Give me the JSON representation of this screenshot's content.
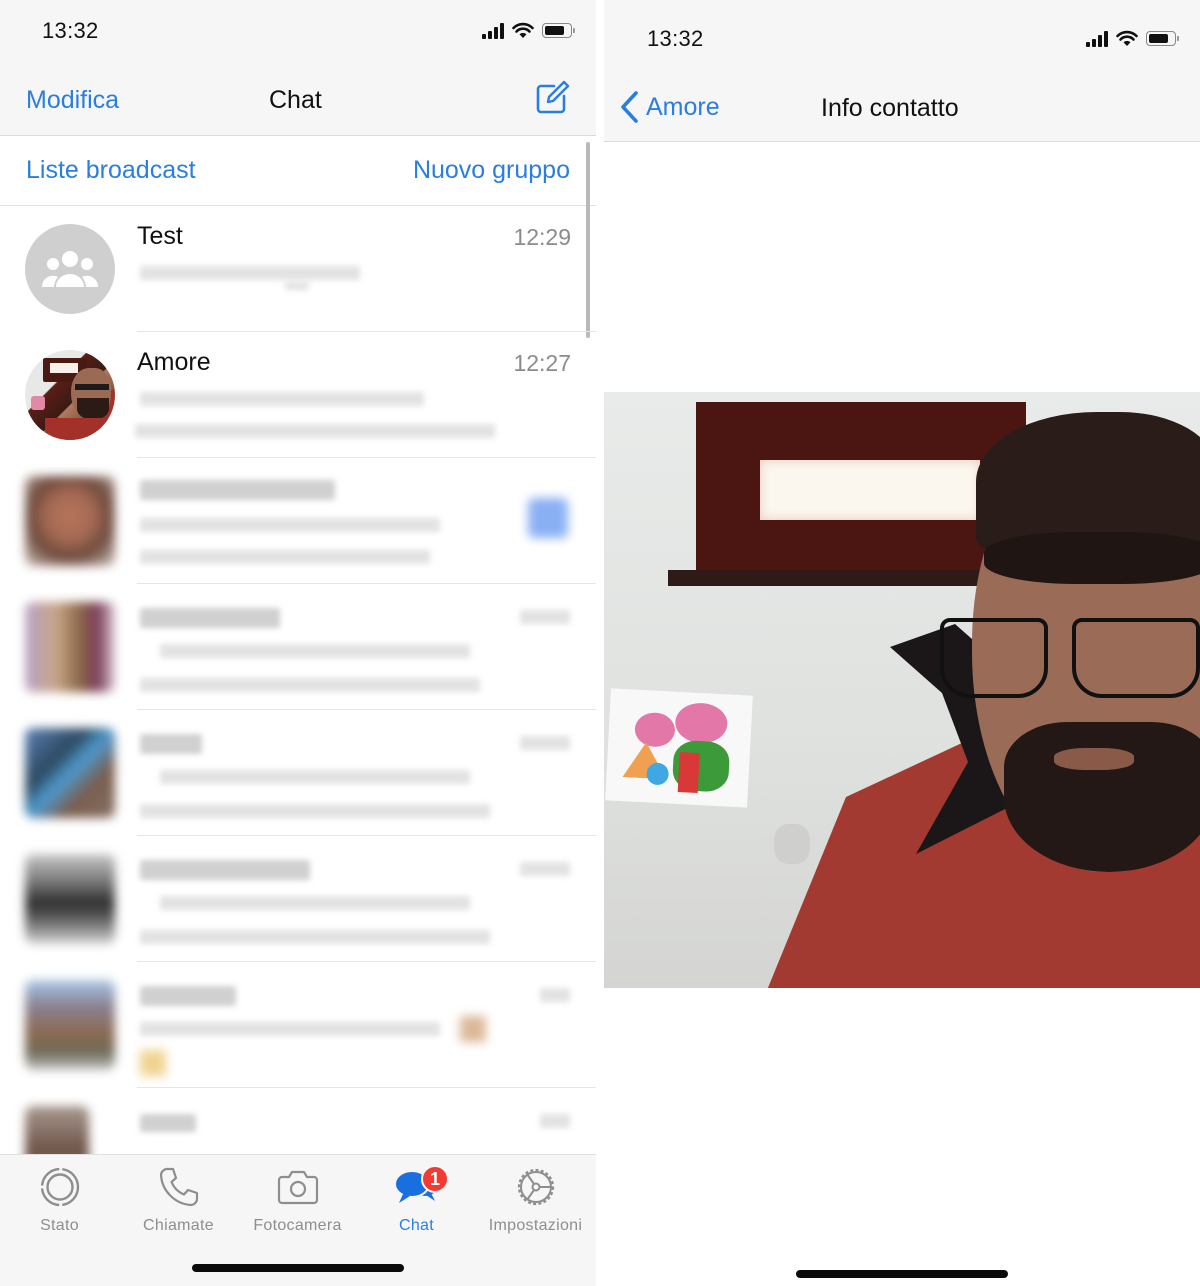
{
  "left_screen": {
    "status_bar": {
      "time": "13:32",
      "icons": [
        "cellular-signal-icon",
        "wifi-icon",
        "battery-icon"
      ]
    },
    "nav": {
      "edit_label": "Modifica",
      "title": "Chat",
      "compose_icon": "compose-icon"
    },
    "sub_actions": {
      "broadcast_label": "Liste broadcast",
      "new_group_label": "Nuovo gruppo"
    },
    "chats": [
      {
        "name": "Test",
        "time": "12:29",
        "avatar": "group-icon",
        "preview": "[blurred]"
      },
      {
        "name": "Amore",
        "time": "12:27",
        "avatar": "contact-photo",
        "preview": "[blurred]"
      },
      {
        "name": "[blurred]",
        "time": "[blurred]",
        "avatar": "blurred-photo",
        "preview": "[blurred]",
        "unread_badge": true
      },
      {
        "name": "[blurred]",
        "time": "[blurred]",
        "avatar": "blurred-photo",
        "preview": "[blurred]"
      },
      {
        "name": "[blurred]",
        "time": "[blurred]",
        "avatar": "blurred-photo",
        "preview": "[blurred]"
      },
      {
        "name": "[blurred]",
        "time": "[blurred]",
        "avatar": "blurred-photo",
        "preview": "[blurred]"
      },
      {
        "name": "[blurred]",
        "time": "[blurred]",
        "avatar": "blurred-photo",
        "preview": "[blurred]"
      },
      {
        "name": "[blurred]",
        "time": "[blurred]",
        "avatar": "blurred-photo",
        "preview": "[blurred]"
      }
    ],
    "tabs": [
      {
        "label": "Stato",
        "icon": "status-ring-icon",
        "active": false
      },
      {
        "label": "Chiamate",
        "icon": "phone-icon",
        "active": false
      },
      {
        "label": "Fotocamera",
        "icon": "camera-icon",
        "active": false
      },
      {
        "label": "Chat",
        "icon": "chat-bubbles-icon",
        "active": true,
        "badge": "1"
      },
      {
        "label": "Impostazioni",
        "icon": "settings-gear-icon",
        "active": false
      }
    ]
  },
  "right_screen": {
    "status_bar": {
      "time": "13:32",
      "icons": [
        "cellular-signal-icon",
        "wifi-icon",
        "battery-icon"
      ]
    },
    "nav": {
      "back_label": "Amore",
      "title": "Info contatto"
    },
    "profile_photo": "contact-profile-photo"
  },
  "colors": {
    "accent": "#2a7ee0",
    "badge": "#f23b33",
    "bar_background": "#f6f6f6",
    "text_primary": "#111111",
    "text_secondary": "#8b8b8b"
  }
}
